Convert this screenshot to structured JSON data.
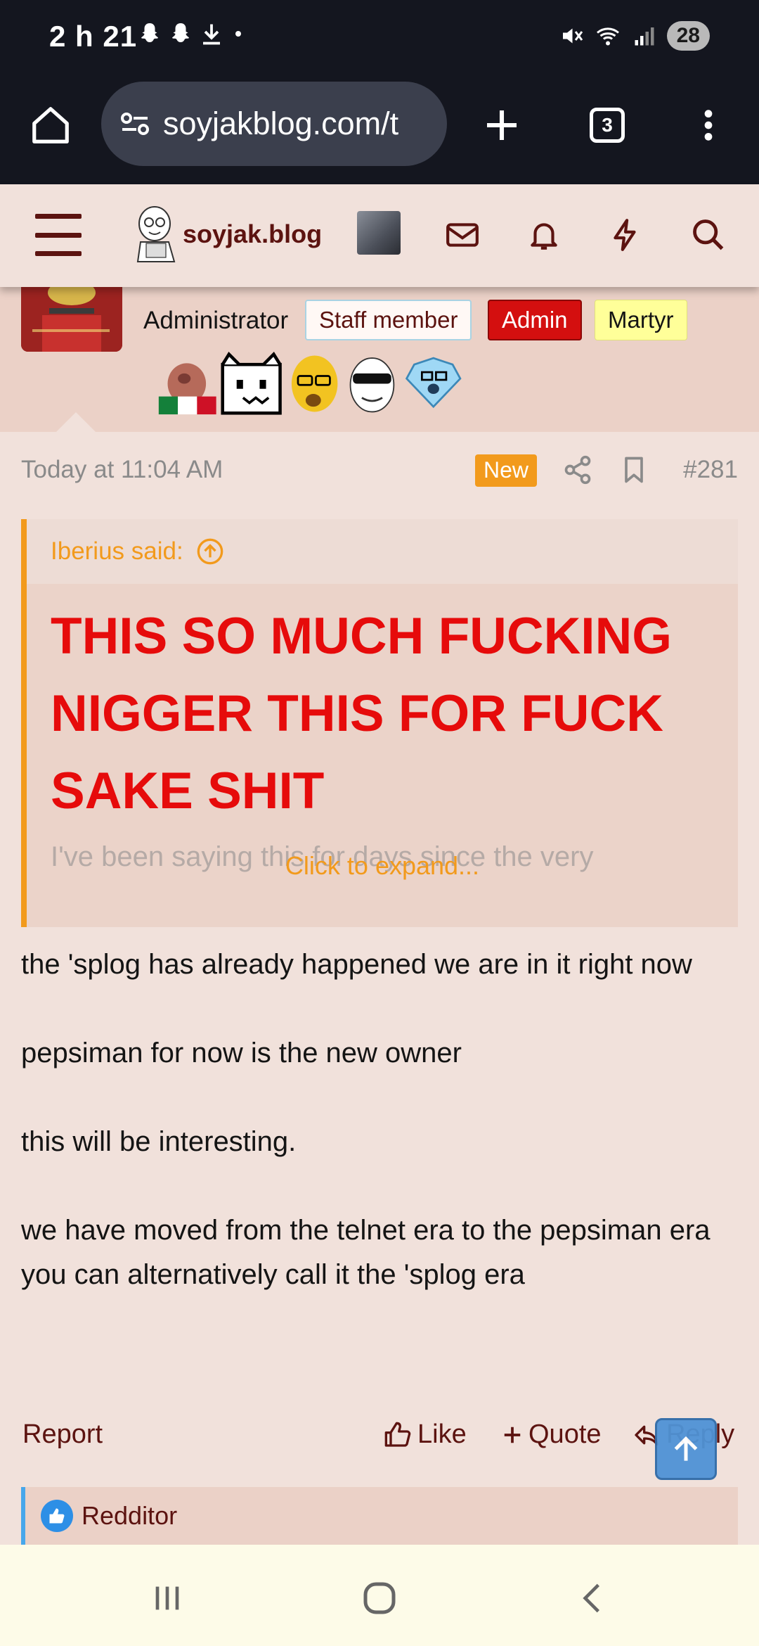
{
  "status_bar": {
    "time": "2 h 21",
    "battery": "28",
    "icons": [
      "snapchat-icon",
      "snapchat-icon",
      "download-icon",
      "dot-icon",
      "mute-icon",
      "wifi-icon",
      "signal-icon"
    ]
  },
  "browser": {
    "url": "soyjakblog.com/t",
    "tab_count": "3"
  },
  "site": {
    "logo_text": "soyjak.blog"
  },
  "user": {
    "title": "Administrator",
    "badges": {
      "staff": "Staff member",
      "admin": "Admin",
      "martyr": "Martyr"
    }
  },
  "message": {
    "date": "Today at 11:04 AM",
    "new_label": "New",
    "number": "#281",
    "quote": {
      "author": "Iberius said:",
      "shout": "THIS SO MUCH FUCKING NIGGER THIS FOR FUCK SAKE SHIT",
      "faded": "I've been saying this for days since the very",
      "expand": "Click to expand..."
    },
    "paragraphs": [
      "the 'splog has already happened we are in it right now",
      "pepsiman for now is the new owner",
      "this will be interesting.",
      "we have moved from the telnet era to the pepsiman era you can alternatively call it the 'splog era"
    ],
    "actions": {
      "report": "Report",
      "like": "Like",
      "quote": "Quote",
      "reply": "Reply"
    },
    "reaction": "Redditor"
  },
  "colors": {
    "brand": "#5c1310",
    "accent": "#f29a1c",
    "shout": "#e60b0b",
    "admin": "#d40f0f",
    "martyr": "#ffff99"
  }
}
